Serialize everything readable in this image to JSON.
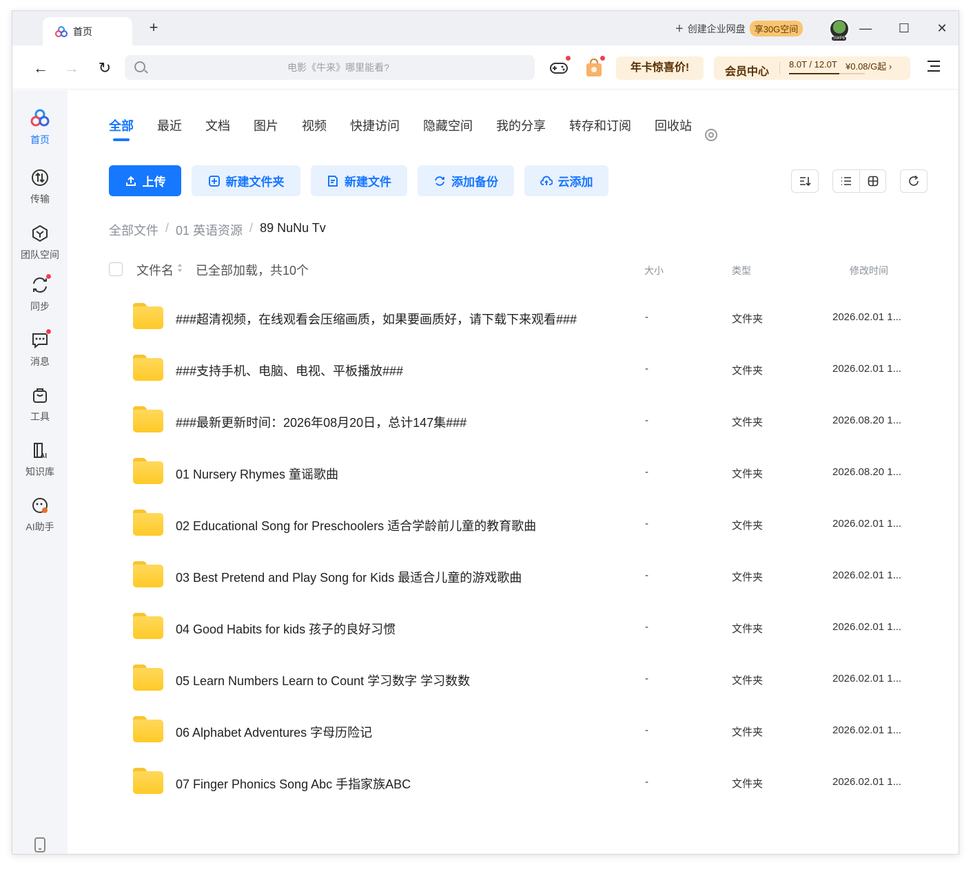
{
  "titlebar": {
    "tab_label": "首页",
    "new_tab": "+",
    "create_enterprise": "创建企业网盘",
    "enterprise_badge": "享30G空间",
    "avatar_tag": "SWP6",
    "minimize": "—",
    "maximize": "☐",
    "close": "✕"
  },
  "navbar": {
    "back": "←",
    "forward": "→",
    "refresh": "↻",
    "search_placeholder": "电影《牛来》哪里能看?",
    "promo_label": "年卡惊喜价!",
    "vip_label": "会员中心",
    "vip_quota": "8.0T / 12.0T",
    "vip_price": "¥0.08/G起 ›",
    "vip_usage_fraction": 0.667
  },
  "sidebar": {
    "items": [
      {
        "label": "首页",
        "icon": "baidu-netdisk-logo-icon",
        "active": true
      },
      {
        "label": "传输",
        "icon": "transfer-icon"
      },
      {
        "label": "团队空间",
        "icon": "team-space-icon"
      },
      {
        "label": "同步",
        "icon": "sync-icon",
        "dot": true
      },
      {
        "label": "消息",
        "icon": "message-icon",
        "dot": true
      },
      {
        "label": "工具",
        "icon": "tools-icon"
      },
      {
        "label": "知识库",
        "icon": "knowledge-base-icon"
      },
      {
        "label": "AI助手",
        "icon": "ai-assistant-icon"
      }
    ]
  },
  "categories": [
    "全部",
    "最近",
    "文档",
    "图片",
    "视频",
    "快捷访问",
    "隐藏空间",
    "我的分享",
    "转存和订阅",
    "回收站"
  ],
  "actions": {
    "upload": "上传",
    "new_folder": "新建文件夹",
    "new_file": "新建文件",
    "add_backup": "添加备份",
    "cloud_add": "云添加"
  },
  "breadcrumb": {
    "root": "全部文件",
    "level1": "01 英语资源",
    "current": "89 NuNu Tv",
    "sep": "/"
  },
  "list_header": {
    "name": "文件名",
    "info": "已全部加载，共10个",
    "size": "大小",
    "type": "类型",
    "mtime": "修改时间"
  },
  "files": [
    {
      "name": "###超清视频，在线观看会压缩画质，如果要画质好，请下载下来观看###",
      "size": "-",
      "type": "文件夹",
      "mtime": "2026.02.01 1..."
    },
    {
      "name": "###支持手机、电脑、电视、平板播放###",
      "size": "-",
      "type": "文件夹",
      "mtime": "2026.02.01 1..."
    },
    {
      "name": "###最新更新时间：2026年08月20日，总计147集###",
      "size": "-",
      "type": "文件夹",
      "mtime": "2026.08.20 1..."
    },
    {
      "name": "01 Nursery Rhymes 童谣歌曲",
      "size": "-",
      "type": "文件夹",
      "mtime": "2026.08.20 1..."
    },
    {
      "name": "02 Educational Song for Preschoolers 适合学龄前儿童的教育歌曲",
      "size": "-",
      "type": "文件夹",
      "mtime": "2026.02.01 1..."
    },
    {
      "name": "03 Best Pretend and Play Song for Kids 最适合儿童的游戏歌曲",
      "size": "-",
      "type": "文件夹",
      "mtime": "2026.02.01 1..."
    },
    {
      "name": "04 Good Habits for kids 孩子的良好习惯",
      "size": "-",
      "type": "文件夹",
      "mtime": "2026.02.01 1..."
    },
    {
      "name": "05 Learn Numbers Learn to Count 学习数字 学习数数",
      "size": "-",
      "type": "文件夹",
      "mtime": "2026.02.01 1..."
    },
    {
      "name": "06 Alphabet Adventures 字母历险记",
      "size": "-",
      "type": "文件夹",
      "mtime": "2026.02.01 1..."
    },
    {
      "name": "07 Finger Phonics Song Abc 手指家族ABC",
      "size": "-",
      "type": "文件夹",
      "mtime": "2026.02.01 1..."
    }
  ],
  "colors": {
    "accent": "#1677ff",
    "folder": "#ffca28",
    "promo_bg": "#fdf1de",
    "notification_dot": "#f23d4f"
  }
}
